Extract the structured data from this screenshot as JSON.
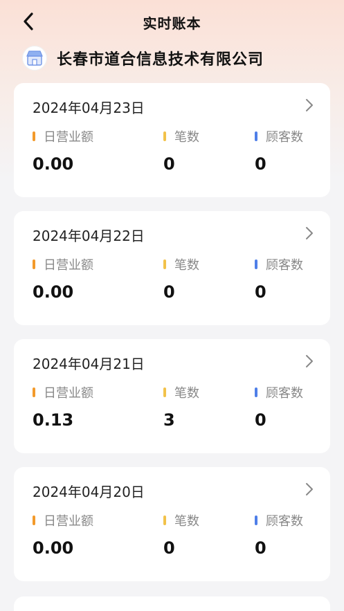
{
  "header": {
    "title": "实时账本"
  },
  "company": {
    "name": "长春市道合信息技术有限公司"
  },
  "colors": {
    "revenue": "#f39a2b",
    "orders": "#f2c24a",
    "customers": "#4f7fe8"
  },
  "labels": {
    "revenue": "日营业额",
    "orders": "笔数",
    "customers": "顾客数"
  },
  "records": [
    {
      "date": "2024年04月23日",
      "revenue": "0.00",
      "orders": "0",
      "customers": "0"
    },
    {
      "date": "2024年04月22日",
      "revenue": "0.00",
      "orders": "0",
      "customers": "0"
    },
    {
      "date": "2024年04月21日",
      "revenue": "0.13",
      "orders": "3",
      "customers": "0"
    },
    {
      "date": "2024年04月20日",
      "revenue": "0.00",
      "orders": "0",
      "customers": "0"
    }
  ]
}
